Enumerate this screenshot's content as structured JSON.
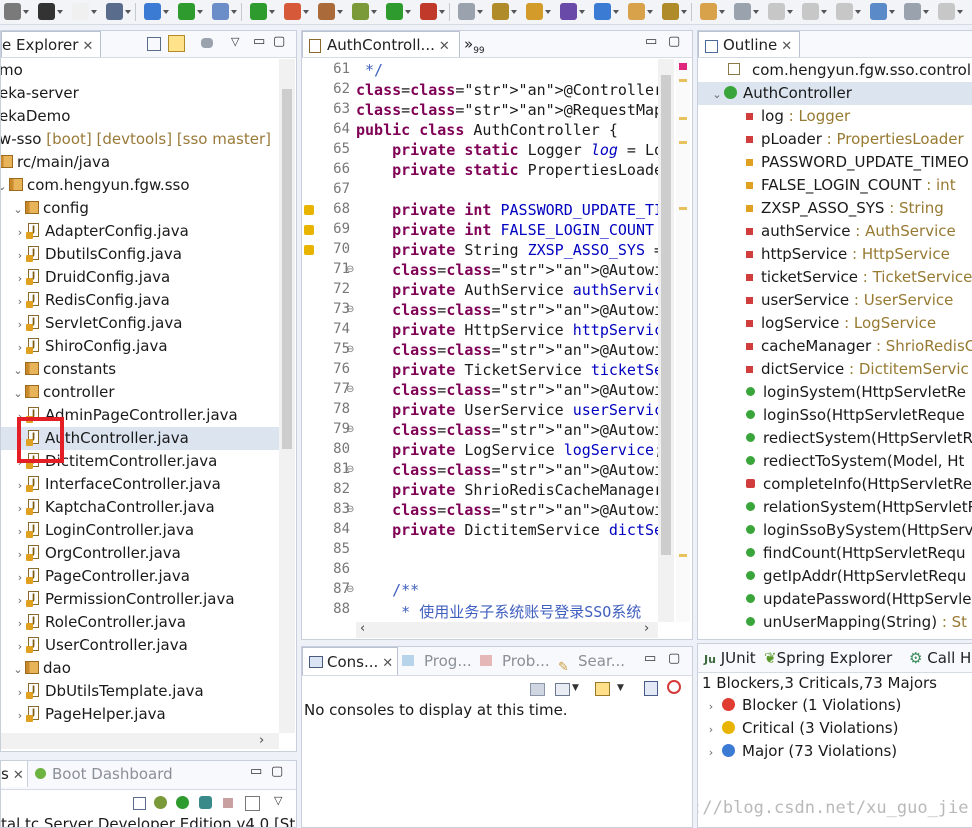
{
  "package_explorer": {
    "title": "e Explorer",
    "rows": [
      {
        "label": "mo",
        "kind": "proj"
      },
      {
        "label": "eka-server",
        "kind": "proj"
      },
      {
        "label": "ekaDemo",
        "kind": "proj"
      },
      {
        "label": "w-sso",
        "kind": "proj",
        "decoration": "[boot] [devtools] [sso master]"
      },
      {
        "label": "rc/main/java",
        "kind": "folder"
      },
      {
        "label": "com.hengyun.fgw.sso",
        "kind": "pkg"
      },
      {
        "label": "config",
        "kind": "pkg"
      },
      {
        "label": "AdapterConfig.java",
        "kind": "java"
      },
      {
        "label": "DbutilsConfig.java",
        "kind": "java"
      },
      {
        "label": "DruidConfig.java",
        "kind": "java"
      },
      {
        "label": "RedisConfig.java",
        "kind": "java"
      },
      {
        "label": "ServletConfig.java",
        "kind": "java"
      },
      {
        "label": "ShiroConfig.java",
        "kind": "java"
      },
      {
        "label": "constants",
        "kind": "pkg"
      },
      {
        "label": "controller",
        "kind": "pkg"
      },
      {
        "label": "AdminPageController.java",
        "kind": "java"
      },
      {
        "label": "AuthController.java",
        "kind": "java",
        "selected": true
      },
      {
        "label": "DictitemController.java",
        "kind": "java"
      },
      {
        "label": "InterfaceController.java",
        "kind": "java"
      },
      {
        "label": "KaptchaController.java",
        "kind": "java"
      },
      {
        "label": "LoginController.java",
        "kind": "java"
      },
      {
        "label": "OrgController.java",
        "kind": "java"
      },
      {
        "label": "PageController.java",
        "kind": "java"
      },
      {
        "label": "PermissionController.java",
        "kind": "java"
      },
      {
        "label": "RoleController.java",
        "kind": "java"
      },
      {
        "label": "UserController.java",
        "kind": "java"
      },
      {
        "label": "dao",
        "kind": "pkg"
      },
      {
        "label": "DbUtilsTemplate.java",
        "kind": "java"
      },
      {
        "label": "PageHelper.java",
        "kind": "java"
      }
    ]
  },
  "editor": {
    "tab_label": "AuthControll...",
    "overflow_label": "»",
    "overflow_count": "99",
    "lines": [
      {
        "n": "61",
        "t": " */"
      },
      {
        "n": "62",
        "t": "@Controller"
      },
      {
        "n": "63",
        "t": "@RequestMapping(value = \"/auth\")"
      },
      {
        "n": "64",
        "t": "public class AuthController {"
      },
      {
        "n": "65",
        "t": "    private static Logger log = Lo"
      },
      {
        "n": "66",
        "t": "    private static PropertiesLoade"
      },
      {
        "n": "67",
        "t": ""
      },
      {
        "n": "68",
        "t": "    private int PASSWORD_UPDATE_TI"
      },
      {
        "n": "69",
        "t": "    private int FALSE_LOGIN_COUNT "
      },
      {
        "n": "70",
        "t": "    private String ZXSP_ASSO_SYS ="
      },
      {
        "n": "71",
        "t": "    @Autowired"
      },
      {
        "n": "72",
        "t": "    private AuthService authServic"
      },
      {
        "n": "73",
        "t": "    @Autowired"
      },
      {
        "n": "74",
        "t": "    private HttpService httpServic"
      },
      {
        "n": "75",
        "t": "    @Autowired"
      },
      {
        "n": "76",
        "t": "    private TicketService ticketSe"
      },
      {
        "n": "77",
        "t": "    @Autowired"
      },
      {
        "n": "78",
        "t": "    private UserService userServic"
      },
      {
        "n": "79",
        "t": "    @Autowired"
      },
      {
        "n": "80",
        "t": "    private LogService logService;"
      },
      {
        "n": "81",
        "t": "    @Autowired"
      },
      {
        "n": "82",
        "t": "    private ShrioRedisCacheManager"
      },
      {
        "n": "83",
        "t": "    @Autowired"
      },
      {
        "n": "84",
        "t": "    private DictitemService dictSe"
      },
      {
        "n": "85",
        "t": ""
      },
      {
        "n": "86",
        "t": ""
      },
      {
        "n": "87",
        "t": "    /**"
      },
      {
        "n": "88",
        "t": "     * 使用业务子系统账号登录SSO系统"
      }
    ]
  },
  "outline": {
    "title": "Outline",
    "items": [
      {
        "name": "com.hengyun.fgw.sso.controll",
        "type": "",
        "kind": "import"
      },
      {
        "name": "AuthController",
        "type": "",
        "kind": "class"
      },
      {
        "name": "log",
        "type": "Logger",
        "kind": "sfield"
      },
      {
        "name": "pLoader",
        "type": "PropertiesLoader",
        "kind": "sfield"
      },
      {
        "name": "PASSWORD_UPDATE_TIMEO",
        "type": "",
        "kind": "field"
      },
      {
        "name": "FALSE_LOGIN_COUNT",
        "type": "int",
        "kind": "field"
      },
      {
        "name": "ZXSP_ASSO_SYS",
        "type": "String",
        "kind": "field"
      },
      {
        "name": "authService",
        "type": "AuthService",
        "kind": "pfield"
      },
      {
        "name": "httpService",
        "type": "HttpService",
        "kind": "pfield"
      },
      {
        "name": "ticketService",
        "type": "TicketService",
        "kind": "pfield"
      },
      {
        "name": "userService",
        "type": "UserService",
        "kind": "pfield"
      },
      {
        "name": "logService",
        "type": "LogService",
        "kind": "pfield"
      },
      {
        "name": "cacheManager",
        "type": "ShrioRedisC",
        "kind": "pfield"
      },
      {
        "name": "dictService",
        "type": "DictitemServic",
        "kind": "pfield"
      },
      {
        "name": "loginSystem(HttpServletRe",
        "type": "",
        "kind": "method"
      },
      {
        "name": "loginSso(HttpServletReque",
        "type": "",
        "kind": "method"
      },
      {
        "name": "rediectSystem(HttpServletR",
        "type": "",
        "kind": "method"
      },
      {
        "name": "rediectToSystem(Model, Ht",
        "type": "",
        "kind": "method"
      },
      {
        "name": "completeInfo(HttpServletRe",
        "type": "",
        "kind": "method-err"
      },
      {
        "name": "relationSystem(HttpServletR",
        "type": "",
        "kind": "method"
      },
      {
        "name": "loginSsoBySystem(HttpServ",
        "type": "",
        "kind": "method"
      },
      {
        "name": "findCount(HttpServletRequ",
        "type": "",
        "kind": "method"
      },
      {
        "name": "getIpAddr(HttpServletRequ",
        "type": "",
        "kind": "method"
      },
      {
        "name": "updatePassword(HttpServle",
        "type": "",
        "kind": "method"
      },
      {
        "name": "unUserMapping(String)",
        "type": "St",
        "kind": "method"
      }
    ]
  },
  "console": {
    "tabs": [
      "Cons...",
      "Prog...",
      "Prob...",
      "Sear..."
    ],
    "message": "No consoles to display at this time."
  },
  "sonar": {
    "tabs": [
      "JUnit",
      "Spring Explorer",
      "Call H"
    ],
    "summary": "1 Blockers,3 Criticals,73 Majors",
    "groups": [
      {
        "label": "Blocker (1 Violations)",
        "color": "#e03c31"
      },
      {
        "label": "Critical (3 Violations)",
        "color": "#e8b400"
      },
      {
        "label": "Major (73 Violations)",
        "color": "#3b7bd4"
      }
    ]
  },
  "boot_dashboard": {
    "title": "Boot Dashboard",
    "server_label": "tal tc Server Developer Edition v4.0 [Sto"
  },
  "left_tab_stub": "s",
  "watermark": "https://blog.csdn.net/xu_guo_jie"
}
